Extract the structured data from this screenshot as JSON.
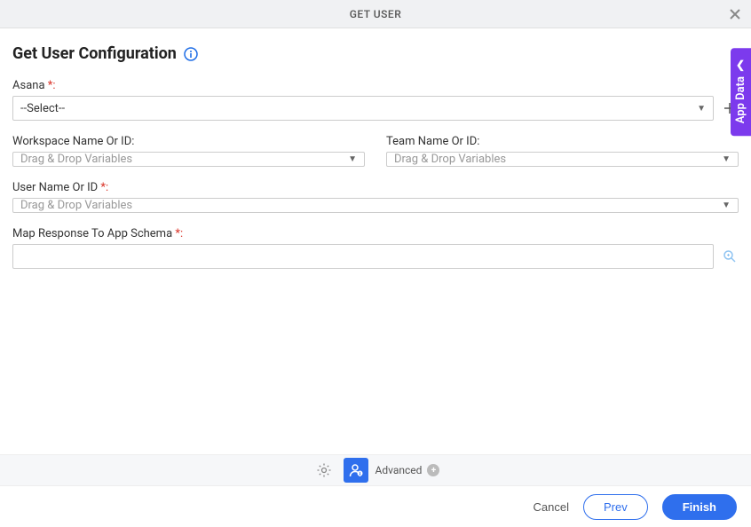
{
  "header": {
    "title": "GET USER"
  },
  "page": {
    "title": "Get User Configuration"
  },
  "form": {
    "asana": {
      "label": "Asana ",
      "required": "*:",
      "value": "--Select--"
    },
    "workspace": {
      "label": "Workspace Name Or ID:",
      "placeholder": "Drag & Drop Variables"
    },
    "team": {
      "label": "Team Name Or ID:",
      "placeholder": "Drag & Drop Variables"
    },
    "user": {
      "label": "User Name Or ID ",
      "required": "*:",
      "placeholder": "Drag & Drop Variables"
    },
    "map_response": {
      "label": "Map Response To App Schema ",
      "required": "*:"
    }
  },
  "sidebar": {
    "app_data": "App Data"
  },
  "toolbar": {
    "advanced": "Advanced"
  },
  "footer": {
    "cancel": "Cancel",
    "prev": "Prev",
    "finish": "Finish"
  }
}
